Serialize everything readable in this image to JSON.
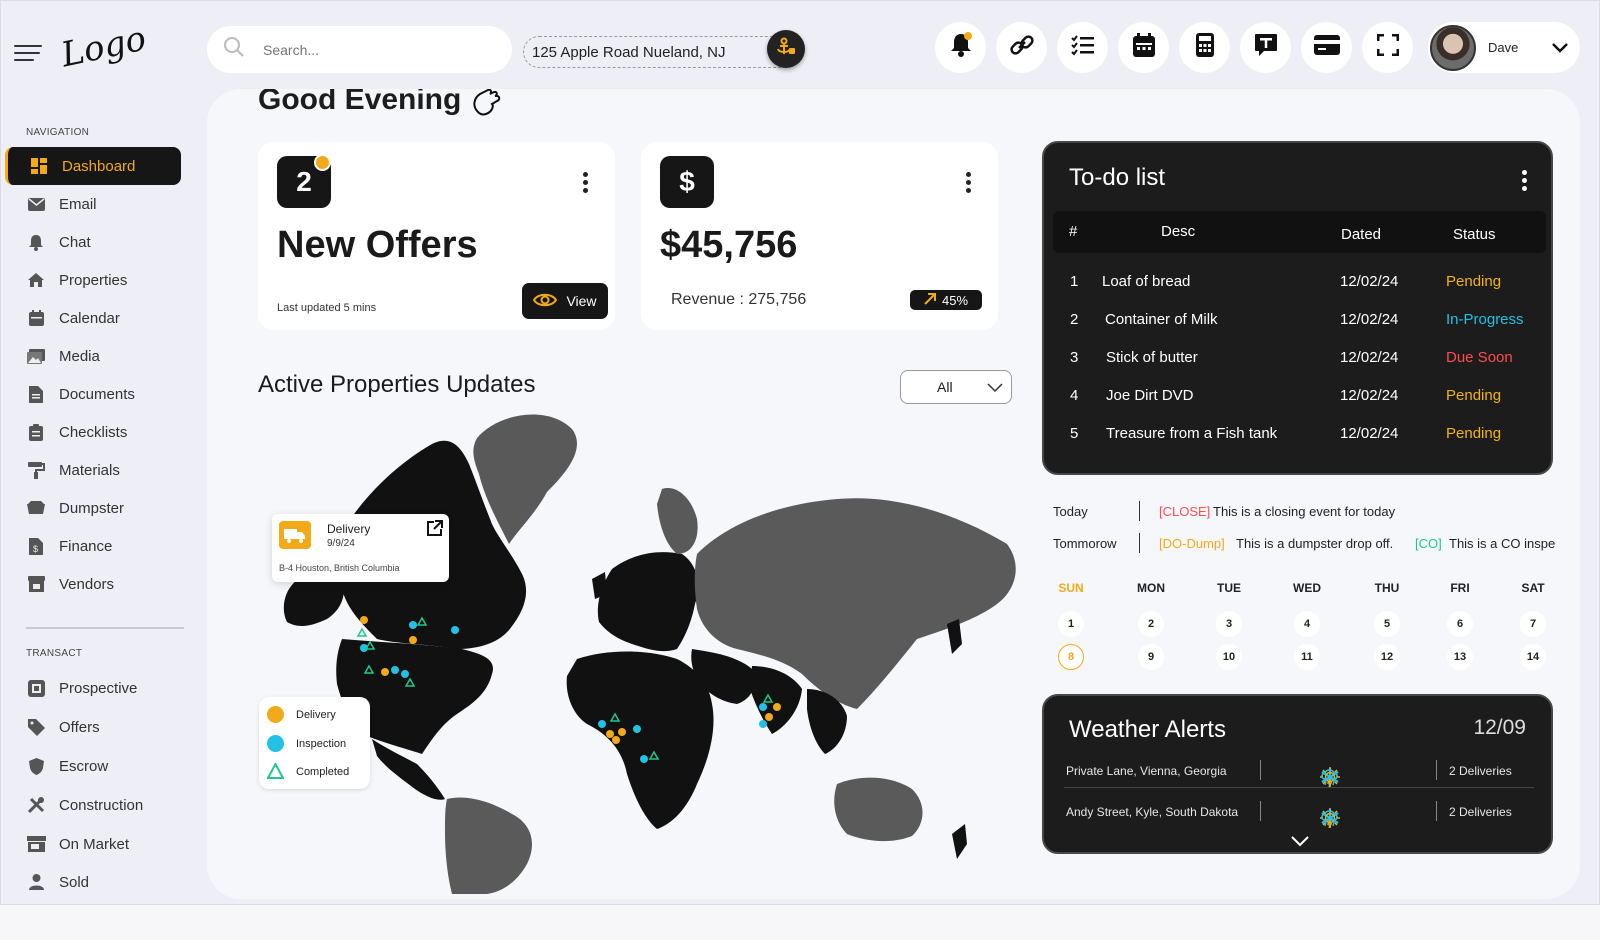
{
  "sidebar": {
    "nav_heading": "NAVIGATION",
    "items": [
      {
        "label": "Dashboard"
      },
      {
        "label": "Email"
      },
      {
        "label": "Chat"
      },
      {
        "label": "Properties"
      },
      {
        "label": "Calendar"
      },
      {
        "label": "Media"
      },
      {
        "label": "Documents"
      },
      {
        "label": "Checklists"
      },
      {
        "label": "Materials"
      },
      {
        "label": "Dumpster"
      },
      {
        "label": "Finance"
      },
      {
        "label": "Vendors"
      }
    ],
    "transact_heading": "TRANSACT",
    "transact_items": [
      {
        "label": "Prospective"
      },
      {
        "label": "Offers"
      },
      {
        "label": "Escrow"
      },
      {
        "label": "Construction"
      },
      {
        "label": "On Market"
      },
      {
        "label": "Sold"
      }
    ],
    "logo_text": "Logo"
  },
  "topbar": {
    "search_placeholder": "Search...",
    "address": "125 Apple Road Nueland, NJ",
    "user_name": "Dave"
  },
  "greeting": "Good Evening",
  "offers_card": {
    "count": "2",
    "title": "New Offers",
    "updated": "Last updated 5 mins",
    "view_label": "View"
  },
  "revenue_card": {
    "icon": "$",
    "amount": "$45,756",
    "revenue": "Revenue : 275,756",
    "change": "45%"
  },
  "properties": {
    "title": "Active Properties Updates",
    "filter": "All",
    "popup": {
      "type": "Delivery",
      "date": "9/9/24",
      "address": "B-4 Houston, British Columbia"
    },
    "legend": [
      "Delivery",
      "Inspection",
      "Completed"
    ]
  },
  "todo": {
    "title": "To-do list",
    "headers": {
      "num": "#",
      "desc": "Desc",
      "dated": "Dated",
      "status": "Status"
    },
    "rows": [
      {
        "num": "1",
        "desc": "Loaf of bread",
        "dated": "12/02/24",
        "status": "Pending",
        "kind": "pending"
      },
      {
        "num": "2",
        "desc": "Container of Milk",
        "dated": "12/02/24",
        "status": "In-Progress",
        "kind": "progress"
      },
      {
        "num": "3",
        "desc": "Stick of butter",
        "dated": "12/02/24",
        "status": "Due Soon",
        "kind": "due"
      },
      {
        "num": "4",
        "desc": "Joe Dirt DVD",
        "dated": "12/02/24",
        "status": "Pending",
        "kind": "pending"
      },
      {
        "num": "5",
        "desc": "Treasure from a Fish tank",
        "dated": "12/02/24",
        "status": "Pending",
        "kind": "pending"
      }
    ]
  },
  "events": {
    "today_label": "Today",
    "today_tag": "[CLOSE]",
    "today_text": "This is a closing event for today",
    "tomorrow_label": "Tommorow",
    "tomorrow_tag1": "[DO-Dump]",
    "tomorrow_text1": "This is a dumpster drop off.",
    "tomorrow_tag2": "[CO]",
    "tomorrow_text2": "This is a CO inspe"
  },
  "calendar": {
    "days": [
      "SUN",
      "MON",
      "TUE",
      "WED",
      "THU",
      "FRI",
      "SAT"
    ],
    "week1": [
      "1",
      "2",
      "3",
      "4",
      "5",
      "6",
      "7"
    ],
    "week2": [
      "8",
      "9",
      "10",
      "11",
      "12",
      "13",
      "14"
    ],
    "today": "8"
  },
  "weather": {
    "title": "Weather Alerts",
    "date": "12/09",
    "rows": [
      {
        "location": "Private Lane, Vienna, Georgia",
        "deliveries": "2 Deliveries"
      },
      {
        "location": "Andy Street, Kyle, South Dakota",
        "deliveries": "2 Deliveries"
      }
    ]
  },
  "colors": {
    "accent": "#f2a91a",
    "dark": "#161616",
    "inspection": "#23c1e6",
    "completed": "#1ec98b",
    "due": "#ff4d4d"
  }
}
